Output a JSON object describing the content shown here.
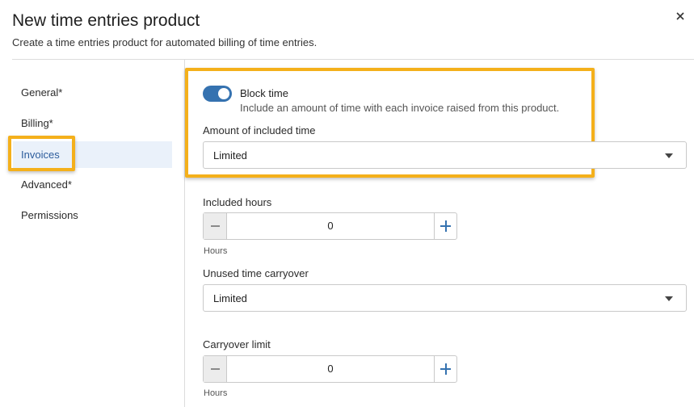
{
  "dialog": {
    "title": "New time entries product",
    "subtitle": "Create a time entries product for automated billing of time entries.",
    "close_icon": "close-icon"
  },
  "nav": {
    "items": [
      {
        "label": "General*"
      },
      {
        "label": "Billing*"
      },
      {
        "label": "Invoices",
        "active": true
      },
      {
        "label": "Advanced*"
      },
      {
        "label": "Permissions"
      }
    ]
  },
  "block_time": {
    "enabled": true,
    "label": "Block time",
    "help": "Include an amount of time with each invoice raised from this product."
  },
  "amount_of_included_time": {
    "label": "Amount of included time",
    "value": "Limited"
  },
  "included_hours": {
    "label": "Included hours",
    "value": "0",
    "unit": "Hours"
  },
  "unused_time_carryover": {
    "label": "Unused time carryover",
    "value": "Limited"
  },
  "carryover_limit": {
    "label": "Carryover limit",
    "value": "0",
    "unit": "Hours"
  },
  "colors": {
    "accent": "#3572b0",
    "highlight": "#f4b01b",
    "active_nav_bg": "#eaf1fa"
  }
}
